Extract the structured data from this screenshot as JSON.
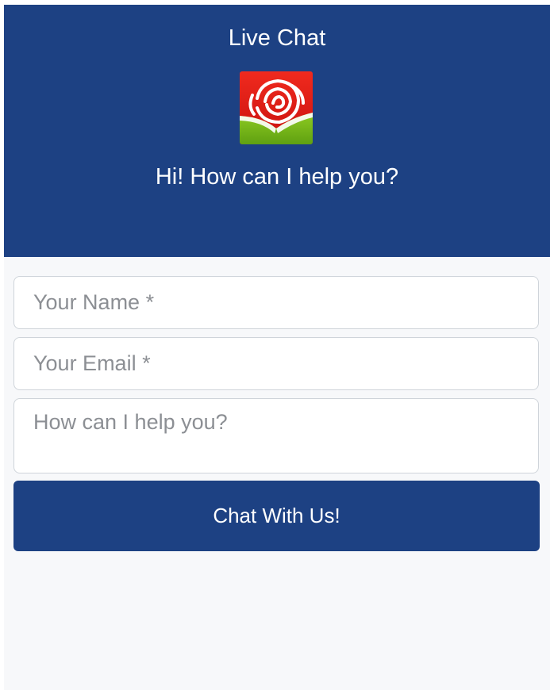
{
  "header": {
    "title": "Live Chat",
    "logo_icon": "rose-icon",
    "greeting": "Hi! How can I help you?"
  },
  "form": {
    "name_placeholder": "Your Name *",
    "email_placeholder": "Your Email *",
    "message_placeholder": "How can I help you?",
    "submit_label": "Chat With Us!"
  },
  "colors": {
    "primary": "#1d4183",
    "background": "#f7f8fa",
    "field_border": "#cfd4da",
    "logo_red": "#e11d1d",
    "logo_green": "#7cbc1c"
  }
}
